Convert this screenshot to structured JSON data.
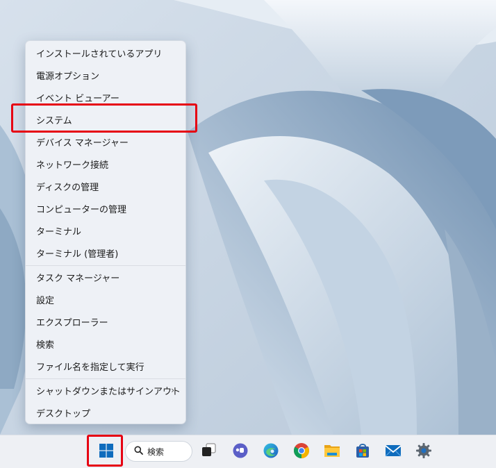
{
  "context_menu": {
    "items": [
      {
        "label": "インストールされているアプリ"
      },
      {
        "label": "電源オプション"
      },
      {
        "label": "イベント ビューアー"
      },
      {
        "label": "システム"
      },
      {
        "label": "デバイス マネージャー"
      },
      {
        "label": "ネットワーク接続"
      },
      {
        "label": "ディスクの管理"
      },
      {
        "label": "コンピューターの管理"
      },
      {
        "label": "ターミナル"
      },
      {
        "label": "ターミナル (管理者)"
      },
      {
        "label": "タスク マネージャー"
      },
      {
        "label": "設定"
      },
      {
        "label": "エクスプローラー"
      },
      {
        "label": "検索"
      },
      {
        "label": "ファイル名を指定して実行"
      },
      {
        "label": "シャットダウンまたはサインアウト",
        "submenu_icon": "chevron-right-icon"
      },
      {
        "label": "デスクトップ"
      }
    ],
    "highlighted_item": "システム"
  },
  "taskbar": {
    "search": {
      "label": "検索",
      "icon": "search-icon"
    },
    "icons": [
      "start-icon",
      "task-view-icon",
      "teams-chat-icon",
      "edge-icon",
      "chrome-icon",
      "file-explorer-icon",
      "store-icon",
      "mail-icon",
      "settings-icon"
    ]
  },
  "colors": {
    "highlight_outline": "#e60012",
    "menu_background": "#eef1f6",
    "taskbar_background": "#eef0f4",
    "windows_blue": "#0f6cbd"
  }
}
